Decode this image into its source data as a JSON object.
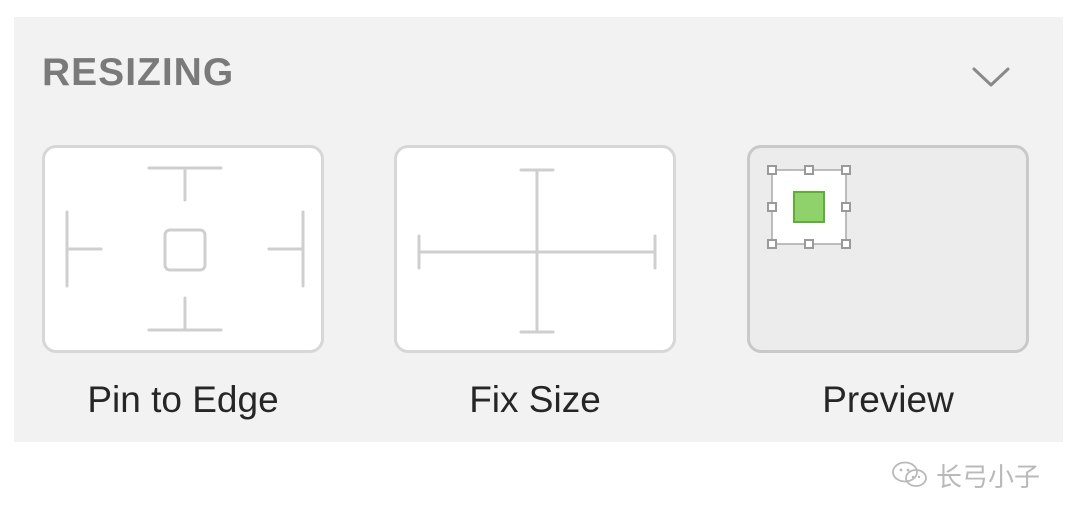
{
  "section": {
    "title": "RESIZING",
    "collapse_icon": "chevron-down-icon"
  },
  "options": [
    {
      "label": "Pin to Edge",
      "icon": "pin-to-edge-icon"
    },
    {
      "label": "Fix Size",
      "icon": "fix-size-icon"
    },
    {
      "label": "Preview",
      "icon": "resize-preview-icon"
    }
  ],
  "colors": {
    "panel_bg": "#f2f2f2",
    "tile_border": "#d7d7d7",
    "preview_fill": "#8fd16a",
    "preview_stroke": "#5fae35",
    "handle_color": "#9a9a9a"
  },
  "watermark": {
    "icon": "wechat-icon",
    "text": "长弓小子"
  }
}
